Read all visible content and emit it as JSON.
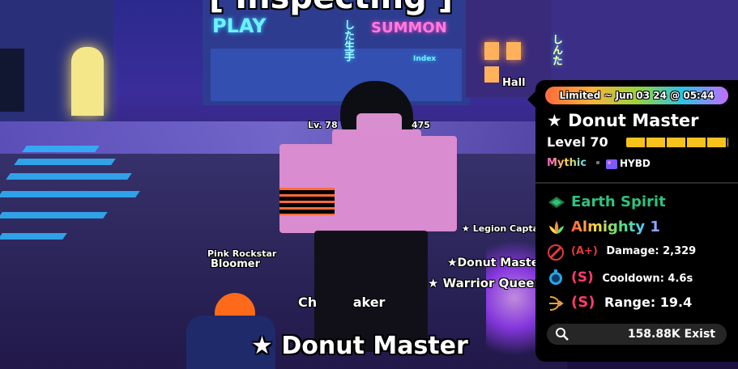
{
  "scene": {
    "banner_title": "[ Inspecting ]",
    "signs": {
      "play": "PLAY",
      "summon": "SUMMON",
      "index": "Index",
      "hall": "Hall",
      "jp_left": "した生手",
      "jp_right": "しんた"
    },
    "nameplates": {
      "level_prefix": "Lv. 78",
      "level_suffix": "475",
      "legion": "★ Legion Capta",
      "donut_small": "★Donut Maste",
      "warrior_queen": "★ Warrior Queen",
      "pink_rockstar": "Pink Rockstar",
      "bloomer": "Bloomer",
      "chakaker": "Ch        aker"
    },
    "bottom_title": "★ Donut Master"
  },
  "panel": {
    "limited_label": "Limited ~ Jun 03 24 @ 05:44",
    "unit_name": "★ Donut Master",
    "level_label": "Level 70",
    "level_progress": 1.0,
    "rarity": "Mythic",
    "origin": "HYBD",
    "trait": "Earth Spirit",
    "trait_color": "#2ec27e",
    "passive_name": "Almighty",
    "passive_rank": "1",
    "stats": [
      {
        "grade": "(A+)",
        "label": "Damage: 2,329",
        "grade_color": "#e23b3b"
      },
      {
        "grade": "(S)",
        "label": "Cooldown: 4.6s",
        "grade_color": "#ff3b6b"
      },
      {
        "grade": "(S)",
        "label": "Range: 19.4",
        "grade_color": "#ff3b6b"
      }
    ],
    "exist_count": "158.88K Exist"
  },
  "icons": {
    "trait": "earth-leaf-icon",
    "passive": "lotus-icon",
    "damage": "sword-icon",
    "cooldown": "stopwatch-icon",
    "range": "bow-icon",
    "search": "magnifier-icon",
    "origin": "origin-badge-icon"
  }
}
